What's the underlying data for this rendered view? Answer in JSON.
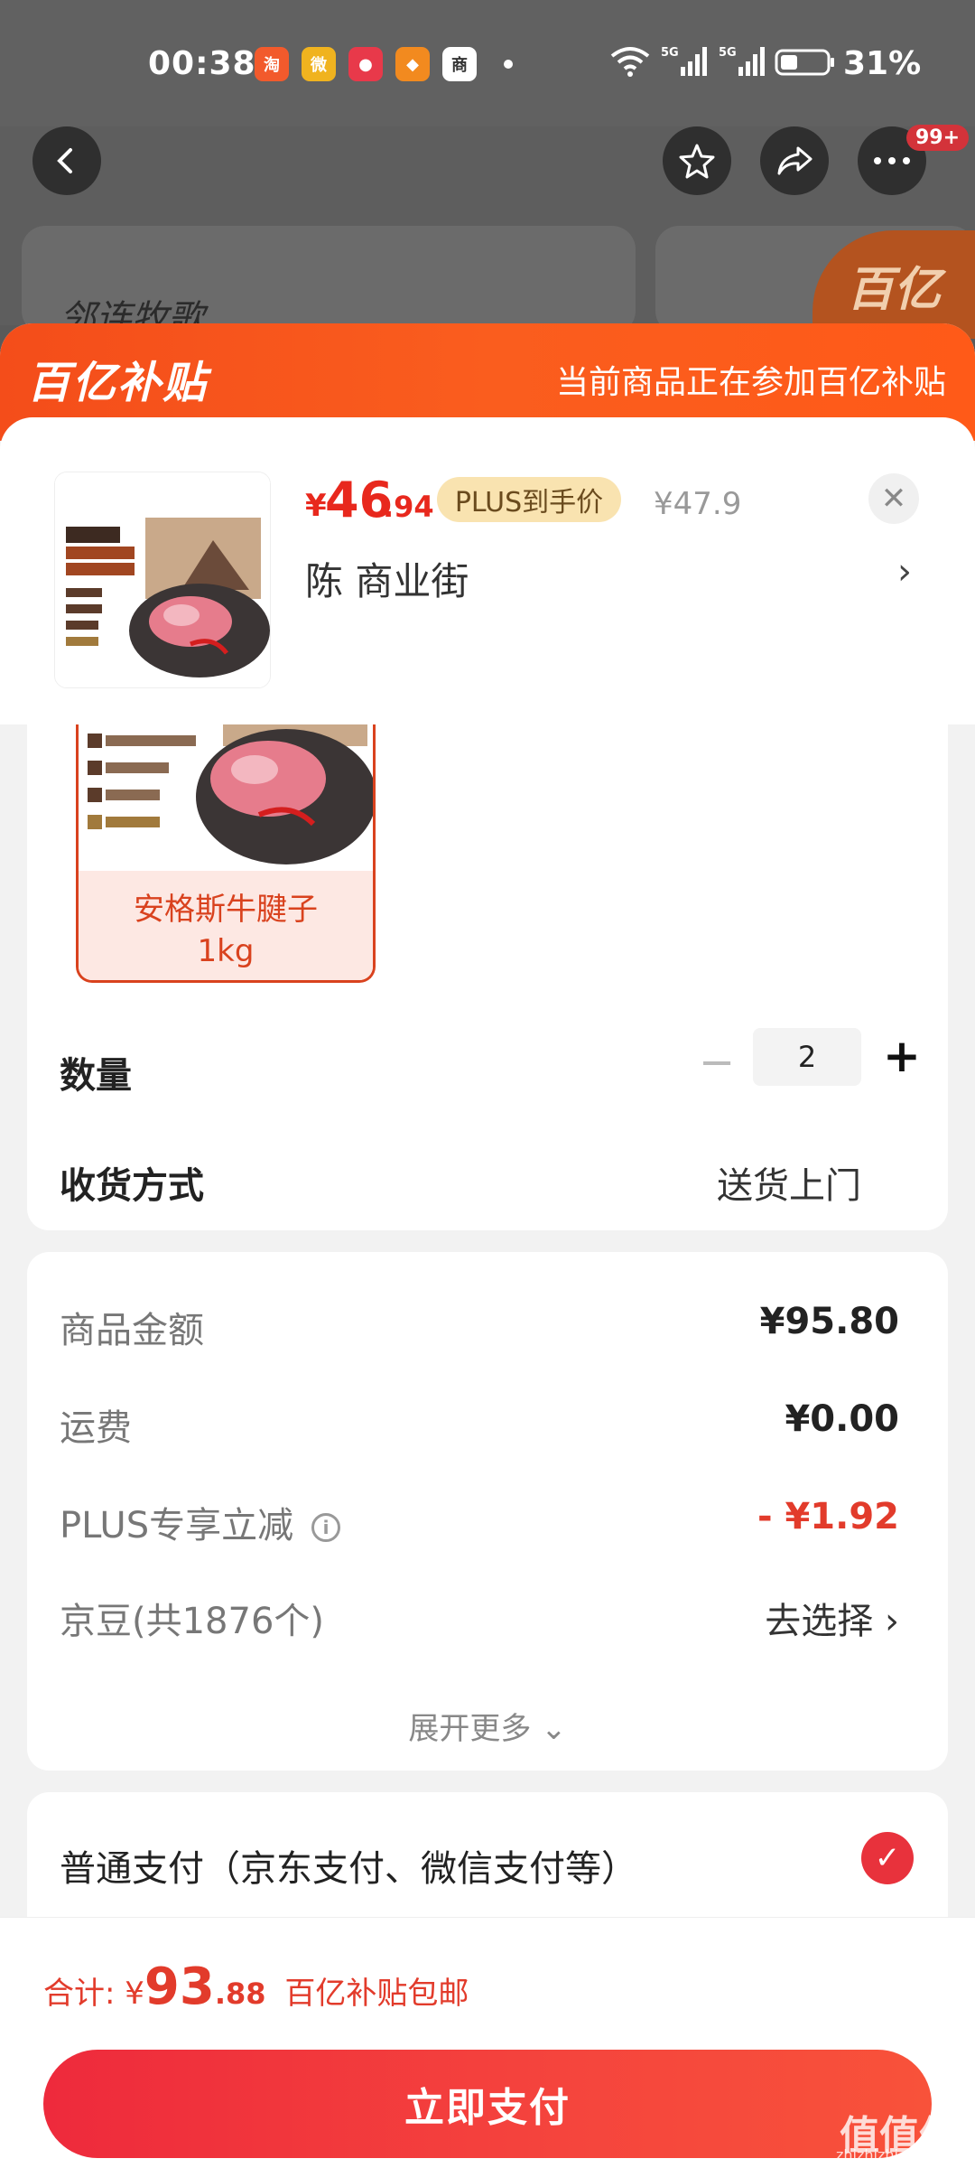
{
  "status_bar": {
    "time": "00:38",
    "battery": "31%",
    "network": "5G",
    "notification_icons": [
      {
        "name": "taobao-icon",
        "glyph": "淘",
        "color": "#f25a2c"
      },
      {
        "name": "weibo-icon",
        "glyph": "微",
        "color": "#f0b31f"
      },
      {
        "name": "app-icon",
        "glyph": "●",
        "color": "#e8394a"
      },
      {
        "name": "app2-icon",
        "glyph": "◆",
        "color": "#f28a1f"
      },
      {
        "name": "app3-icon",
        "glyph": "商",
        "color": "#ffffff"
      }
    ]
  },
  "nav": {
    "back_icon": "back-icon",
    "favorite_icon": "star-icon",
    "share_icon": "share-icon",
    "more_icon": "more-icon",
    "badge": "99+",
    "bg_logo": "邻连牧歌",
    "bg_tag": "百亿"
  },
  "sheet": {
    "brand": "百亿补贴",
    "header_note": "当前商品正在参加百亿补贴",
    "product": {
      "price_symbol": "¥",
      "price_int": "46",
      "price_dec": ".94",
      "plus_tag": "PLUS到手价",
      "original_price": "¥47.9",
      "address": "陈  商业街",
      "close_icon": "close-icon"
    },
    "spec": {
      "label_line1": "安格斯牛腱子",
      "label_line2": "1kg"
    },
    "quantity": {
      "label": "数量",
      "value": "2"
    },
    "shipping": {
      "label": "收货方式",
      "value": "送货上门"
    },
    "cost": {
      "goods_label": "商品金额",
      "goods_value": "¥95.80",
      "freight_label": "运费",
      "freight_value": "¥0.00",
      "plus_label": "PLUS专享立减",
      "plus_value": "- ¥1.92",
      "jingdou_label": "京豆(共1876个)",
      "jingdou_action": "去选择",
      "expand": "展开更多"
    },
    "payment": {
      "label": "普通支付（京东支付、微信支付等）"
    },
    "footer": {
      "total_label": "合计: ¥",
      "total_int": "93",
      "total_dec": ".88",
      "total_note": "百亿补贴包邮",
      "pay_button": "立即支付"
    }
  },
  "watermark": {
    "text": "值值值",
    "sub": "zhizhizhi.com"
  },
  "colors": {
    "accent": "#e8281d",
    "header_orange": "#f44d1a",
    "pay_red": "#ee2a3c"
  }
}
